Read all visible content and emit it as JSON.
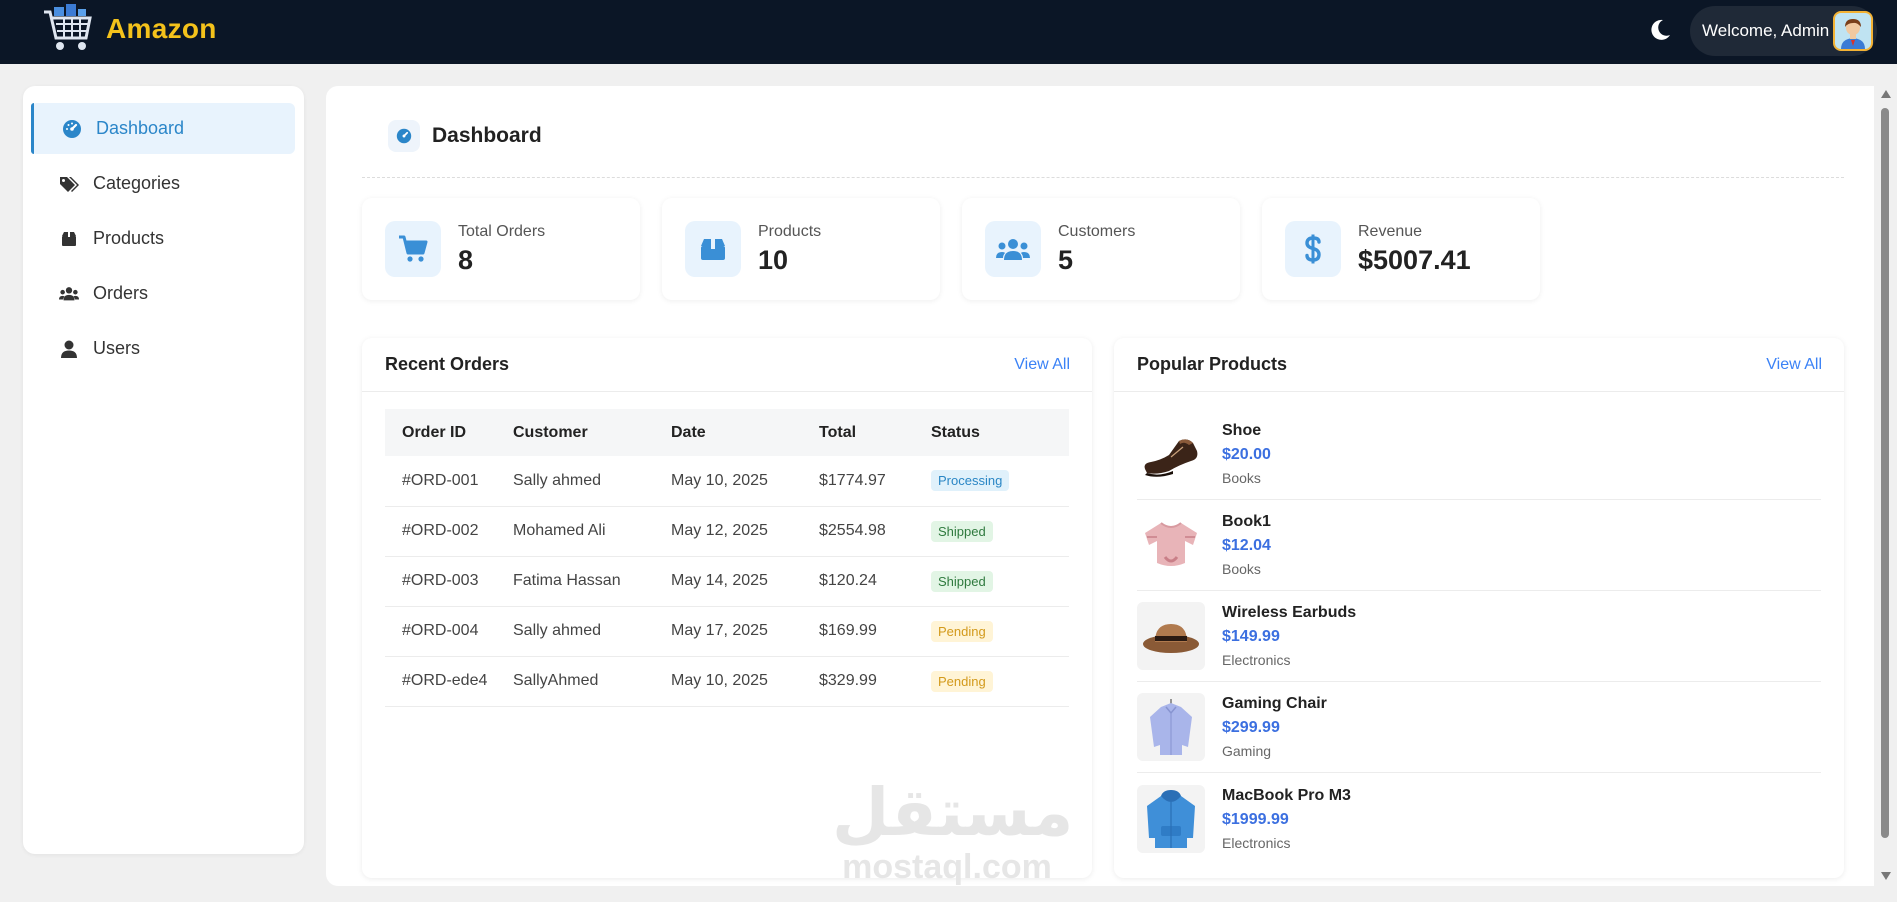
{
  "topbar": {
    "brand_name": "Amazon",
    "welcome_text": "Welcome, Admin",
    "brand_color": "#f4c21b",
    "background": "#0b1626"
  },
  "sidebar": {
    "items": [
      {
        "label": "Dashboard",
        "icon": "gauge-icon",
        "active": true
      },
      {
        "label": "Categories",
        "icon": "tags-icon",
        "active": false
      },
      {
        "label": "Products",
        "icon": "box-icon",
        "active": false
      },
      {
        "label": "Orders",
        "icon": "users-icon",
        "active": false
      },
      {
        "label": "Users",
        "icon": "user-icon",
        "active": false
      }
    ]
  },
  "page": {
    "title": "Dashboard",
    "accent": "#2b86c9"
  },
  "stats": [
    {
      "label": "Total Orders",
      "value": "8",
      "icon": "cart-icon"
    },
    {
      "label": "Products",
      "value": "10",
      "icon": "box-icon"
    },
    {
      "label": "Customers",
      "value": "5",
      "icon": "users-icon"
    },
    {
      "label": "Revenue",
      "value": "$5007.41",
      "icon": "dollar-icon"
    }
  ],
  "recent_orders": {
    "title": "Recent Orders",
    "view_all": "View All",
    "columns": [
      "Order ID",
      "Customer",
      "Date",
      "Total",
      "Status"
    ],
    "rows": [
      {
        "id": "#ORD-001",
        "customer": "Sally ahmed",
        "date": "May 10, 2025",
        "total": "$1774.97",
        "status": "Processing"
      },
      {
        "id": "#ORD-002",
        "customer": "Mohamed Ali",
        "date": "May 12, 2025",
        "total": "$2554.98",
        "status": "Shipped"
      },
      {
        "id": "#ORD-003",
        "customer": "Fatima Hassan",
        "date": "May 14, 2025",
        "total": "$120.24",
        "status": "Shipped"
      },
      {
        "id": "#ORD-004",
        "customer": "Sally ahmed",
        "date": "May 17, 2025",
        "total": "$169.99",
        "status": "Pending"
      },
      {
        "id": "#ORD-ede4",
        "customer": "SallyAhmed",
        "date": "May 10, 2025",
        "total": "$329.99",
        "status": "Pending"
      }
    ]
  },
  "popular_products": {
    "title": "Popular Products",
    "view_all": "View All",
    "items": [
      {
        "name": "Shoe",
        "price": "$20.00",
        "category": "Books",
        "image": "shoe-image"
      },
      {
        "name": "Book1",
        "price": "$12.04",
        "category": "Books",
        "image": "blouse-image"
      },
      {
        "name": "Wireless Earbuds",
        "price": "$149.99",
        "category": "Electronics",
        "image": "hat-image"
      },
      {
        "name": "Gaming Chair",
        "price": "$299.99",
        "category": "Gaming",
        "image": "shirt-image"
      },
      {
        "name": "MacBook Pro M3",
        "price": "$1999.99",
        "category": "Electronics",
        "image": "hoodie-image"
      }
    ]
  },
  "watermark": {
    "arabic": "مستقل",
    "latin": "mostaql.com"
  }
}
